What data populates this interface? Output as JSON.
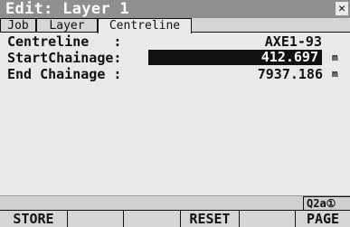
{
  "window": {
    "title": "Edit: Layer 1",
    "close_symbol": "✕"
  },
  "tabs": [
    {
      "label": "Job",
      "active": false
    },
    {
      "label": "Layer",
      "active": false
    },
    {
      "label": "Centreline",
      "active": true
    }
  ],
  "fields": {
    "centreline": {
      "label": "Centreline   :",
      "value": "AXE1-93"
    },
    "start_chainage": {
      "label": "StartChainage:",
      "value": "412.697",
      "unit": "m"
    },
    "end_chainage": {
      "label": "End Chainage :",
      "value": "7937.186",
      "unit": "m"
    }
  },
  "status": {
    "indicator": "Q2a①"
  },
  "softkeys": [
    "STORE",
    "",
    "",
    "RESET",
    "",
    "PAGE"
  ],
  "colors": {
    "titlebar": "#8f8f8f",
    "background": "#e9e9e9",
    "selected_input": "#111111"
  }
}
